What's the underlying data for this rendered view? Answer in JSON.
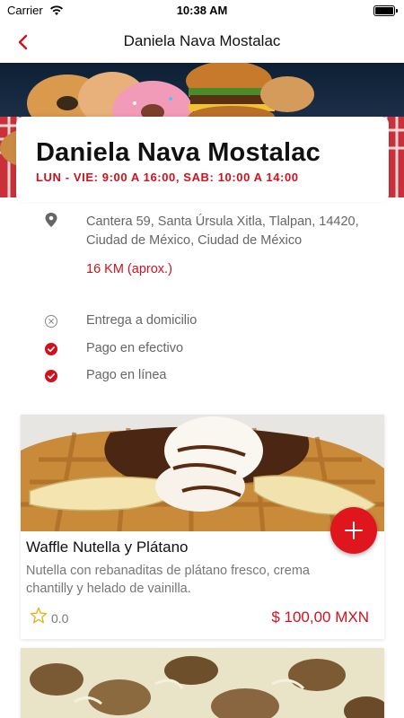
{
  "status_bar": {
    "carrier": "Carrier",
    "time": "10:38 AM"
  },
  "nav": {
    "title": "Daniela Nava Mostalac",
    "back_icon": "chevron-left-icon"
  },
  "restaurant": {
    "name": "Daniela Nava Mostalac",
    "hours": "LUN - VIE: 9:00 A 16:00, SAB: 10:00 A 14:00",
    "address": "Cantera 59, Santa Úrsula Xitla, Tlalpan, 14420, Ciudad de México, Ciudad de México",
    "distance": "16 KM (aprox.)"
  },
  "features": [
    {
      "label": "Entrega a domicilio",
      "enabled": false
    },
    {
      "label": "Pago en efectivo",
      "enabled": true
    },
    {
      "label": "Pago en línea",
      "enabled": true
    }
  ],
  "products": [
    {
      "name": "Waffle Nutella y Plátano",
      "description": "Nutella con rebanaditas de plátano fresco, crema chantilly y helado de vainilla.",
      "rating": "0.0",
      "price": "$ 100,00 MXN"
    }
  ],
  "colors": {
    "accent": "#d0121e",
    "add_button": "#e0161f"
  }
}
